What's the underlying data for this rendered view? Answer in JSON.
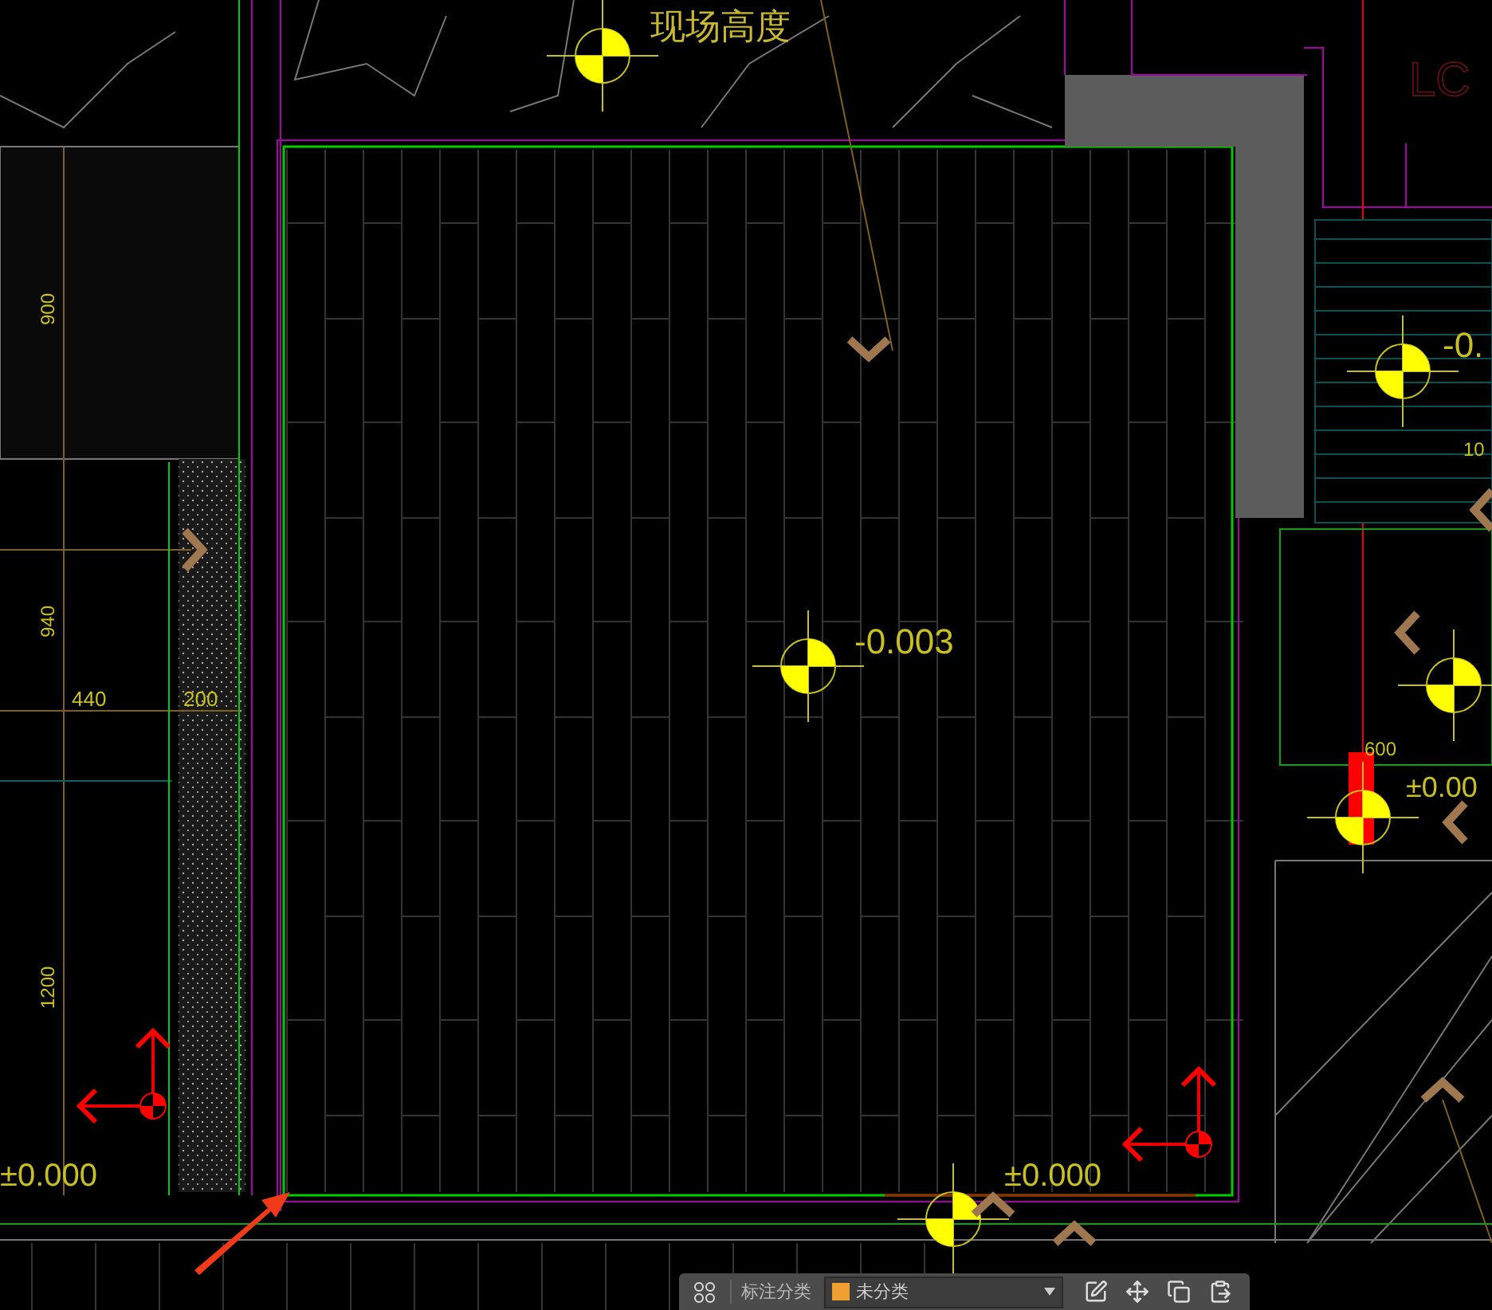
{
  "drawing": {
    "labels": [
      {
        "kind": "note",
        "text": "现场高度"
      },
      {
        "kind": "faint",
        "text": "LC"
      },
      {
        "kind": "elevation",
        "text": "-0.003"
      },
      {
        "kind": "elevation",
        "text": "-0."
      },
      {
        "kind": "dimension",
        "text": "10"
      },
      {
        "kind": "dimension",
        "text": "600"
      },
      {
        "kind": "elevation",
        "text": "±0.00"
      },
      {
        "kind": "dimension",
        "text": "900"
      },
      {
        "kind": "dimension",
        "text": "940"
      },
      {
        "kind": "dimension",
        "text": "440"
      },
      {
        "kind": "dimension",
        "text": "200"
      },
      {
        "kind": "dimension",
        "text": "1200"
      },
      {
        "kind": "elevation",
        "text": "±0.000"
      },
      {
        "kind": "elevation",
        "text": "±0.000"
      }
    ]
  },
  "toolbar": {
    "label": "标注分类",
    "category": {
      "name": "未分类",
      "color": "#f0a030"
    }
  }
}
